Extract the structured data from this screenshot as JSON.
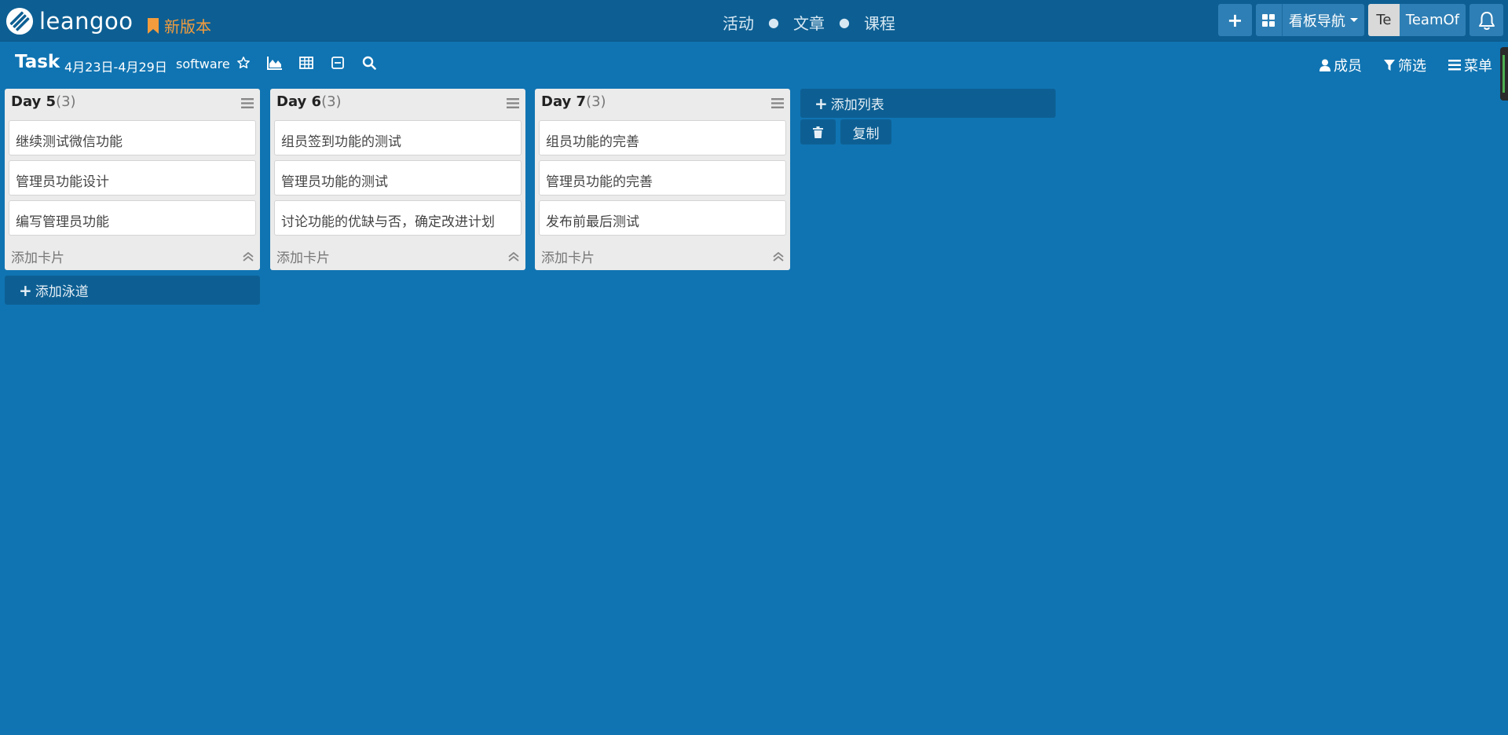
{
  "topbar": {
    "logo_text": "leangoo",
    "new_version": "新版本",
    "center_nav": [
      "活动",
      "文章",
      "课程"
    ],
    "add_label": "+",
    "board_nav": "看板导航",
    "team_initials": "Te",
    "team_name": "TeamOf",
    "accent_color": "#f39c3d"
  },
  "board": {
    "title": "Task",
    "date_range": "4月23日-4月29日",
    "project": "software",
    "icons": [
      "star-icon",
      "chart-icon",
      "table-icon",
      "collapse-icon",
      "search-icon"
    ],
    "members_label": "成员",
    "filter_label": "筛选",
    "menu_label": "菜单"
  },
  "lists": [
    {
      "name": "Day 5",
      "count": "(3)",
      "cards": [
        "继续测试微信功能",
        "管理员功能设计",
        "编写管理员功能"
      ],
      "add_card": "添加卡片"
    },
    {
      "name": "Day 6",
      "count": "(3)",
      "cards": [
        "组员签到功能的测试",
        "管理员功能的测试",
        "讨论功能的优缺与否，确定改进计划"
      ],
      "add_card": "添加卡片"
    },
    {
      "name": "Day 7",
      "count": "(3)",
      "cards": [
        "组员功能的完善",
        "管理员功能的完善",
        "发布前最后测试"
      ],
      "add_card": "添加卡片"
    }
  ],
  "add_list_label": "添加列表",
  "copy_label": "复制",
  "add_swimlane_label": "添加泳道"
}
